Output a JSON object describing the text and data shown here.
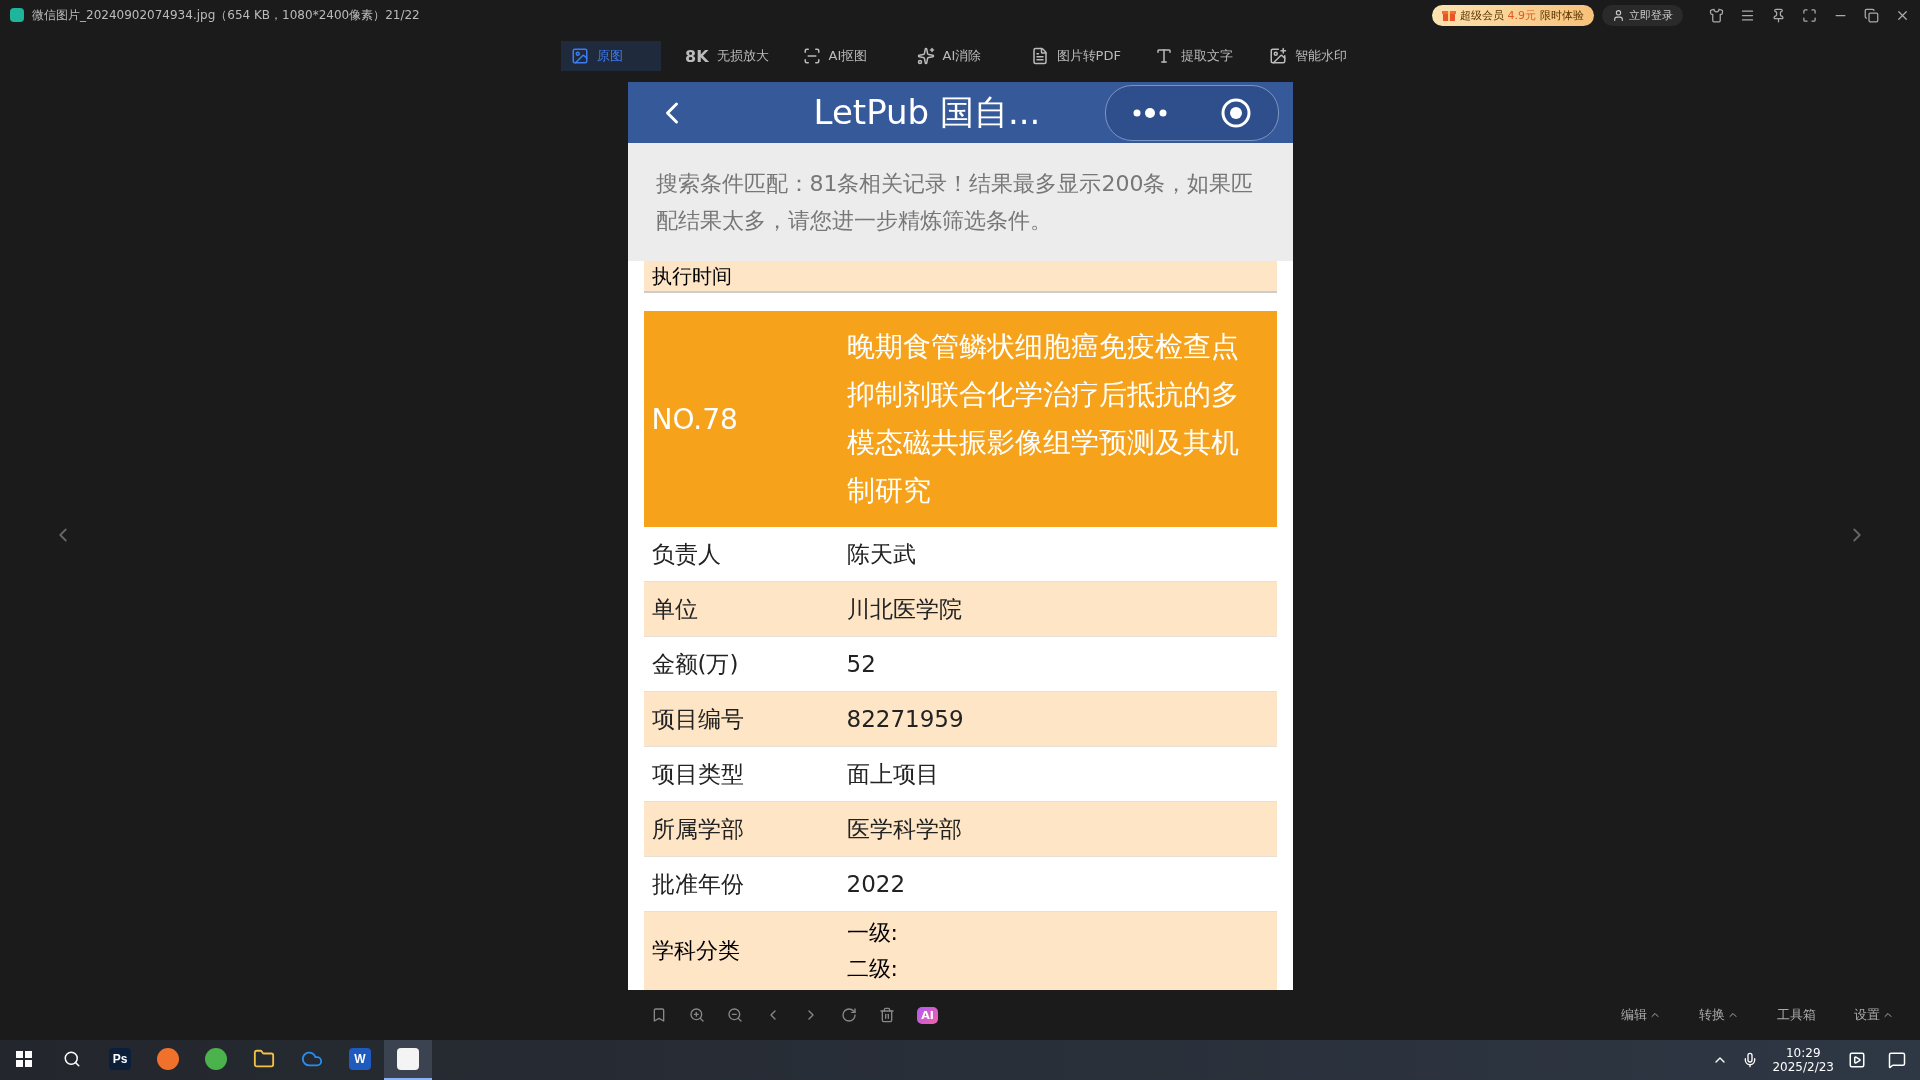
{
  "window": {
    "title": "微信图片_20240902074934.jpg（654 KB，1080*2400像素）21/22",
    "promo": {
      "prefix": "超级会员",
      "price": "4.9元",
      "suffix": "限时体验"
    },
    "login": "立即登录"
  },
  "toolbar": [
    {
      "label": "原图",
      "selected": true
    },
    {
      "label": "无损放大",
      "badge": "8K",
      "selected": false
    },
    {
      "label": "AI抠图",
      "selected": false
    },
    {
      "label": "AI消除",
      "selected": false
    },
    {
      "label": "图片转PDF",
      "selected": false
    },
    {
      "label": "提取文字",
      "selected": false
    },
    {
      "label": "智能水印",
      "selected": false
    }
  ],
  "ai_badge": "AI",
  "phone": {
    "title": "LetPub 国自...",
    "notice": "搜索条件匹配：81条相关记录！结果最多显示200条，如果匹配结果太多，请您进一步精炼筛选条件。",
    "top_row": "执行时间",
    "record": {
      "number": "NO.78",
      "title": "晚期食管鳞状细胞癌免疫检查点抑制剂联合化学治疗后抵抗的多模态磁共振影像组学预测及其机制研究"
    },
    "rows": [
      {
        "label": "负责人",
        "value": "陈天武"
      },
      {
        "label": "单位",
        "value": "川北医学院"
      },
      {
        "label": "金额(万)",
        "value": "52"
      },
      {
        "label": "项目编号",
        "value": "82271959"
      },
      {
        "label": "项目类型",
        "value": "面上项目"
      },
      {
        "label": "所属学部",
        "value": "医学科学部"
      },
      {
        "label": "批准年份",
        "value": "2022"
      }
    ],
    "classification": {
      "label": "学科分类",
      "levels": [
        "一级:",
        "二级:"
      ]
    }
  },
  "bottom_menu": [
    {
      "label": "编辑",
      "has_menu": true
    },
    {
      "label": "转换",
      "has_menu": true
    },
    {
      "label": "工具箱",
      "has_menu": false
    },
    {
      "label": "设置",
      "has_menu": true
    }
  ],
  "taskbar": {
    "time": "10:29",
    "date": "2025/2/23",
    "apps": [
      {
        "label": "Ps",
        "active": false
      },
      {
        "active": false
      },
      {
        "active": false
      },
      {
        "active": false
      },
      {
        "active": false
      },
      {
        "label": "W",
        "active": false
      },
      {
        "active": true
      }
    ]
  }
}
